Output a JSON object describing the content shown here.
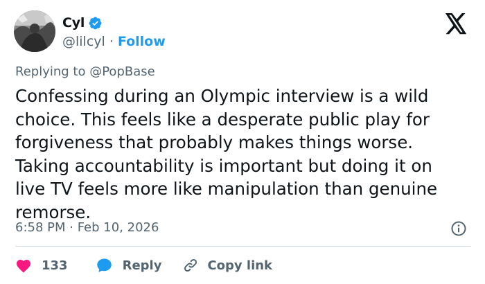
{
  "author": {
    "display_name": "Cyl",
    "handle": "@lilcyl",
    "separator": "·",
    "follow_label": "Follow"
  },
  "reply_context": {
    "prefix": "Replying to",
    "mention": "@PopBase"
  },
  "tweet": {
    "text_lines": [
      "Confessing during an Olympic interview is a wild",
      "choice. This feels like a desperate public play for",
      "forgiveness that probably makes things worse.",
      "Taking accountability is important but doing it on",
      "live TV feels more like manipulation than genuine",
      "remorse."
    ],
    "timestamp": "6:58 PM · Feb 10, 2026"
  },
  "actions": {
    "like_count": "133",
    "reply_label": "Reply",
    "copy_label": "Copy link"
  },
  "icons": {
    "verified": "verified-badge-icon",
    "logo": "x-logo-icon",
    "info": "info-icon",
    "like": "heart-icon",
    "reply": "speech-bubble-icon",
    "copy": "link-icon"
  },
  "colors": {
    "text": "#0f1419",
    "secondary": "#536471",
    "accent": "#1d9bf0",
    "like": "#f91880",
    "divider": "#cfd9de"
  }
}
